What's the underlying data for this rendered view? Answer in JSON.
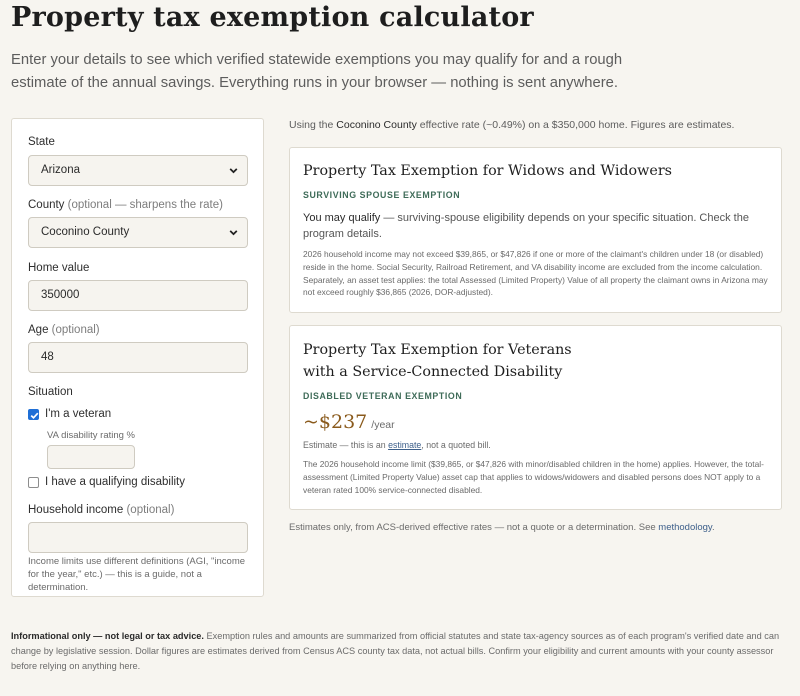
{
  "header": {
    "title": "Property tax exemption calculator",
    "intro": "Enter your details to see which verified statewide exemptions you may qualify for and a rough estimate of the annual savings. Everything runs in your browser — nothing is sent anywhere."
  },
  "form": {
    "state_label": "State",
    "state_value": "Arizona",
    "county_label": "County",
    "county_hint": "(optional — sharpens the rate)",
    "county_value": "Coconino County",
    "home_value_label": "Home value",
    "home_value": "350000",
    "age_label": "Age",
    "age_hint": "(optional)",
    "age_value": "48",
    "situation_label": "Situation",
    "veteran_label": "I'm a veteran",
    "veteran_checked": true,
    "va_rating_label": "VA disability rating %",
    "va_rating_value": "",
    "disability_label": "I have a qualifying disability",
    "disability_checked": false,
    "income_label": "Household income",
    "income_hint": "(optional)",
    "income_value": "",
    "income_note": "Income limits use different definitions (AGI, \"income for the year,\" etc.) — this is a guide, not a determination."
  },
  "results": {
    "rate_prefix": "Using the",
    "rate_county": "Coconino County",
    "rate_suffix": "effective rate (~0.49%) on a $350,000 home. Figures are estimates.",
    "cards": [
      {
        "title": "Property Tax Exemption for Widows and Widowers",
        "tag": "SURVIVING SPOUSE EXEMPTION",
        "lead_strong": "You may qualify",
        "lead_rest": " — surviving-spouse eligibility depends on your specific situation. Check the program details.",
        "detail": "2026 household income may not exceed $39,865, or $47,826 if one or more of the claimant's children under 18 (or disabled) reside in the home. Social Security, Railroad Retirement, and VA disability income are excluded from the income calculation. Separately, an asset test applies: the total Assessed (Limited Property) Value of all property the claimant owns in Arizona may not exceed roughly $36,865 (2026, DOR-adjusted)."
      },
      {
        "title_line1": "Property Tax Exemption for Veterans",
        "title_line2": "with a Service-Connected Disability",
        "tag": "DISABLED VETERAN EXEMPTION",
        "amount": "~$237",
        "per": "/year",
        "est_prefix": "Estimate — this is an",
        "est_link": "estimate",
        "est_suffix": ", not a quoted bill.",
        "detail": "The 2026 household income limit ($39,865, or $47,826 with minor/disabled children in the home) applies. However, the total-assessment (Limited Property Value) asset cap that applies to widows/widowers and disabled persons does NOT apply to a veteran rated 100% service-connected disabled."
      }
    ],
    "bottom_prefix": "Estimates only, from ACS-derived effective rates — not a quote or a determination. See",
    "bottom_link": "methodology",
    "bottom_suffix": "."
  },
  "footer": {
    "lead": "Informational only — not legal or tax advice.",
    "text": " Exemption rules and amounts are summarized from official statutes and state tax-agency sources as of each program's verified date and can change by legislative session. Dollar figures are estimates derived from Census ACS county tax data, not actual bills. Confirm your eligibility and current amounts with your county assessor before relying on anything here."
  },
  "colors": {
    "accent_tag": "#3e6b58",
    "estimate_amount": "#8a5a1c",
    "checkbox_checked": "#1f6fd6",
    "background": "#f7f5f0"
  }
}
